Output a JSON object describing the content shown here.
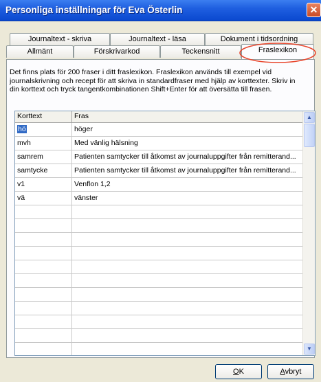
{
  "window": {
    "title": "Personliga inställningar för Eva Österlin",
    "close_glyph": "✕"
  },
  "tabs_top": [
    {
      "label": "Journaltext - skriva"
    },
    {
      "label": "Journaltext - läsa"
    },
    {
      "label": "Dokument i tidsordning"
    }
  ],
  "tabs_bottom": [
    {
      "label": "Allmänt"
    },
    {
      "label": "Förskrivarkod"
    },
    {
      "label": "Teckensnitt"
    },
    {
      "label": "Fraslexikon"
    }
  ],
  "description": "Det finns plats för 200 fraser i ditt fraslexikon. Fraslexikon används till exempel vid journalskrivning och recept för att skriva in standardfraser med hjälp av korttexter. Skriv in din korttext och tryck tangentkombinationen Shift+Enter för att översätta till frasen.",
  "grid": {
    "headers": [
      "Korttext",
      "Fras"
    ],
    "rows": [
      {
        "short": "hö",
        "phrase": "höger"
      },
      {
        "short": "mvh",
        "phrase": "Med vänlig hälsning"
      },
      {
        "short": "samrem",
        "phrase": "Patienten samtycker till åtkomst av journaluppgifter från remitterand..."
      },
      {
        "short": "samtycke",
        "phrase": "Patienten samtycker till åtkomst av journaluppgifter från remitterand..."
      },
      {
        "short": "v1",
        "phrase": "Venflon 1,2"
      },
      {
        "short": "vä",
        "phrase": "vänster"
      }
    ],
    "empty_rows": 11
  },
  "buttons": {
    "ok_mnemonic": "O",
    "ok_rest": "K",
    "cancel_mnemonic": "A",
    "cancel_rest": "vbryt"
  },
  "colors": {
    "titlebar": "#0a48cf",
    "selection": "#316ac5",
    "highlight_oval": "#e8442a"
  }
}
